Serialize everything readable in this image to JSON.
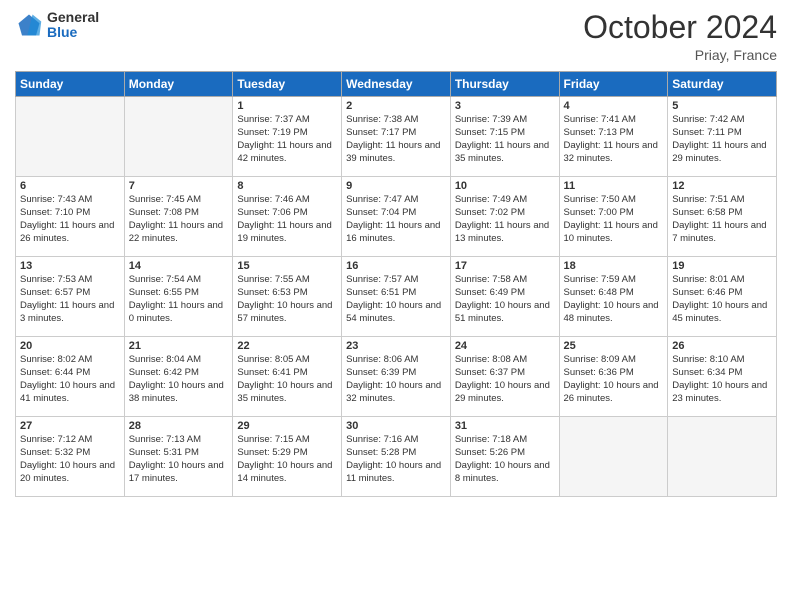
{
  "header": {
    "logo_general": "General",
    "logo_blue": "Blue",
    "month_title": "October 2024",
    "location": "Priay, France"
  },
  "days_of_week": [
    "Sunday",
    "Monday",
    "Tuesday",
    "Wednesday",
    "Thursday",
    "Friday",
    "Saturday"
  ],
  "weeks": [
    [
      {
        "day": "",
        "empty": true
      },
      {
        "day": "",
        "empty": true
      },
      {
        "day": "1",
        "sunrise": "Sunrise: 7:37 AM",
        "sunset": "Sunset: 7:19 PM",
        "daylight": "Daylight: 11 hours and 42 minutes."
      },
      {
        "day": "2",
        "sunrise": "Sunrise: 7:38 AM",
        "sunset": "Sunset: 7:17 PM",
        "daylight": "Daylight: 11 hours and 39 minutes."
      },
      {
        "day": "3",
        "sunrise": "Sunrise: 7:39 AM",
        "sunset": "Sunset: 7:15 PM",
        "daylight": "Daylight: 11 hours and 35 minutes."
      },
      {
        "day": "4",
        "sunrise": "Sunrise: 7:41 AM",
        "sunset": "Sunset: 7:13 PM",
        "daylight": "Daylight: 11 hours and 32 minutes."
      },
      {
        "day": "5",
        "sunrise": "Sunrise: 7:42 AM",
        "sunset": "Sunset: 7:11 PM",
        "daylight": "Daylight: 11 hours and 29 minutes."
      }
    ],
    [
      {
        "day": "6",
        "sunrise": "Sunrise: 7:43 AM",
        "sunset": "Sunset: 7:10 PM",
        "daylight": "Daylight: 11 hours and 26 minutes."
      },
      {
        "day": "7",
        "sunrise": "Sunrise: 7:45 AM",
        "sunset": "Sunset: 7:08 PM",
        "daylight": "Daylight: 11 hours and 22 minutes."
      },
      {
        "day": "8",
        "sunrise": "Sunrise: 7:46 AM",
        "sunset": "Sunset: 7:06 PM",
        "daylight": "Daylight: 11 hours and 19 minutes."
      },
      {
        "day": "9",
        "sunrise": "Sunrise: 7:47 AM",
        "sunset": "Sunset: 7:04 PM",
        "daylight": "Daylight: 11 hours and 16 minutes."
      },
      {
        "day": "10",
        "sunrise": "Sunrise: 7:49 AM",
        "sunset": "Sunset: 7:02 PM",
        "daylight": "Daylight: 11 hours and 13 minutes."
      },
      {
        "day": "11",
        "sunrise": "Sunrise: 7:50 AM",
        "sunset": "Sunset: 7:00 PM",
        "daylight": "Daylight: 11 hours and 10 minutes."
      },
      {
        "day": "12",
        "sunrise": "Sunrise: 7:51 AM",
        "sunset": "Sunset: 6:58 PM",
        "daylight": "Daylight: 11 hours and 7 minutes."
      }
    ],
    [
      {
        "day": "13",
        "sunrise": "Sunrise: 7:53 AM",
        "sunset": "Sunset: 6:57 PM",
        "daylight": "Daylight: 11 hours and 3 minutes."
      },
      {
        "day": "14",
        "sunrise": "Sunrise: 7:54 AM",
        "sunset": "Sunset: 6:55 PM",
        "daylight": "Daylight: 11 hours and 0 minutes."
      },
      {
        "day": "15",
        "sunrise": "Sunrise: 7:55 AM",
        "sunset": "Sunset: 6:53 PM",
        "daylight": "Daylight: 10 hours and 57 minutes."
      },
      {
        "day": "16",
        "sunrise": "Sunrise: 7:57 AM",
        "sunset": "Sunset: 6:51 PM",
        "daylight": "Daylight: 10 hours and 54 minutes."
      },
      {
        "day": "17",
        "sunrise": "Sunrise: 7:58 AM",
        "sunset": "Sunset: 6:49 PM",
        "daylight": "Daylight: 10 hours and 51 minutes."
      },
      {
        "day": "18",
        "sunrise": "Sunrise: 7:59 AM",
        "sunset": "Sunset: 6:48 PM",
        "daylight": "Daylight: 10 hours and 48 minutes."
      },
      {
        "day": "19",
        "sunrise": "Sunrise: 8:01 AM",
        "sunset": "Sunset: 6:46 PM",
        "daylight": "Daylight: 10 hours and 45 minutes."
      }
    ],
    [
      {
        "day": "20",
        "sunrise": "Sunrise: 8:02 AM",
        "sunset": "Sunset: 6:44 PM",
        "daylight": "Daylight: 10 hours and 41 minutes."
      },
      {
        "day": "21",
        "sunrise": "Sunrise: 8:04 AM",
        "sunset": "Sunset: 6:42 PM",
        "daylight": "Daylight: 10 hours and 38 minutes."
      },
      {
        "day": "22",
        "sunrise": "Sunrise: 8:05 AM",
        "sunset": "Sunset: 6:41 PM",
        "daylight": "Daylight: 10 hours and 35 minutes."
      },
      {
        "day": "23",
        "sunrise": "Sunrise: 8:06 AM",
        "sunset": "Sunset: 6:39 PM",
        "daylight": "Daylight: 10 hours and 32 minutes."
      },
      {
        "day": "24",
        "sunrise": "Sunrise: 8:08 AM",
        "sunset": "Sunset: 6:37 PM",
        "daylight": "Daylight: 10 hours and 29 minutes."
      },
      {
        "day": "25",
        "sunrise": "Sunrise: 8:09 AM",
        "sunset": "Sunset: 6:36 PM",
        "daylight": "Daylight: 10 hours and 26 minutes."
      },
      {
        "day": "26",
        "sunrise": "Sunrise: 8:10 AM",
        "sunset": "Sunset: 6:34 PM",
        "daylight": "Daylight: 10 hours and 23 minutes."
      }
    ],
    [
      {
        "day": "27",
        "sunrise": "Sunrise: 7:12 AM",
        "sunset": "Sunset: 5:32 PM",
        "daylight": "Daylight: 10 hours and 20 minutes."
      },
      {
        "day": "28",
        "sunrise": "Sunrise: 7:13 AM",
        "sunset": "Sunset: 5:31 PM",
        "daylight": "Daylight: 10 hours and 17 minutes."
      },
      {
        "day": "29",
        "sunrise": "Sunrise: 7:15 AM",
        "sunset": "Sunset: 5:29 PM",
        "daylight": "Daylight: 10 hours and 14 minutes."
      },
      {
        "day": "30",
        "sunrise": "Sunrise: 7:16 AM",
        "sunset": "Sunset: 5:28 PM",
        "daylight": "Daylight: 10 hours and 11 minutes."
      },
      {
        "day": "31",
        "sunrise": "Sunrise: 7:18 AM",
        "sunset": "Sunset: 5:26 PM",
        "daylight": "Daylight: 10 hours and 8 minutes."
      },
      {
        "day": "",
        "empty": true
      },
      {
        "day": "",
        "empty": true
      }
    ]
  ]
}
